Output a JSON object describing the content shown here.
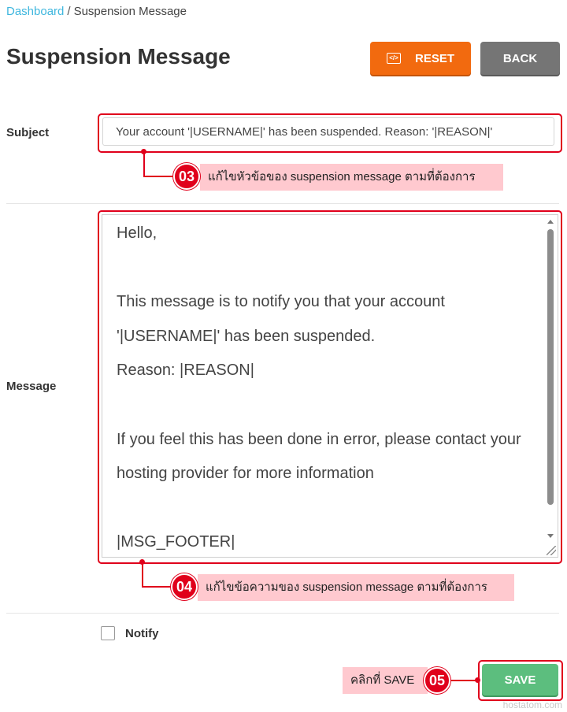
{
  "breadcrumb": {
    "home": "Dashboard",
    "separator": "/",
    "current": "Suspension Message"
  },
  "page_title": "Suspension Message",
  "header_buttons": {
    "reset_label": "RESET",
    "back_label": "BACK",
    "reset_icon": "code-icon"
  },
  "form": {
    "subject_label": "Subject",
    "subject_value": "Your account '|USERNAME|' has been suspended. Reason: '|REASON|'",
    "message_label": "Message",
    "message_lines": [
      "Hello,",
      "",
      "This message is to notify you that your account",
      "'|USERNAME|' has been suspended.",
      "Reason: |REASON|",
      "",
      "If you feel this has been done in error, please contact your",
      "hosting provider for more information",
      "",
      "|MSG_FOOTER|"
    ],
    "notify_label": "Notify",
    "notify_checked": false,
    "save_label": "SAVE"
  },
  "annotations": {
    "step3": {
      "number": "03",
      "text": "แก้ไขหัวข้อของ suspension message ตามที่ต้องการ"
    },
    "step4": {
      "number": "04",
      "text": "แก้ไขข้อความของ suspension message ตามที่ต้องการ"
    },
    "step5": {
      "number": "05",
      "text": "คลิกที่ SAVE"
    }
  },
  "colors": {
    "link": "#3fb7de",
    "reset": "#f26a0f",
    "back": "#757575",
    "save": "#5cbe7e",
    "highlight": "#e0001b",
    "callout_bg": "#ffc9cf"
  },
  "watermark": "hostatom.com"
}
